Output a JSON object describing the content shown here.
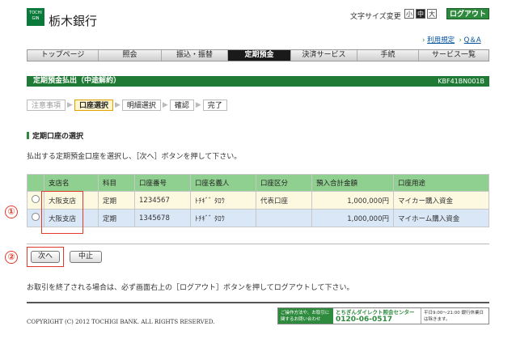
{
  "header": {
    "logo_text": "TOCHI GIN",
    "bank_name": "栃木銀行",
    "font_size_label": "文字サイズ変更",
    "font_sizes": [
      "小",
      "中",
      "大"
    ],
    "logout_label": "ログアウト",
    "links": [
      "利用規定",
      "Q＆A"
    ]
  },
  "nav": {
    "items": [
      "トップページ",
      "照会",
      "振込・振替",
      "定期預金",
      "決済サービス",
      "手続",
      "サービス一覧"
    ],
    "active_index": 3
  },
  "page": {
    "title": "定期預金払出（中途解約）",
    "code": "KBF41BN001B"
  },
  "steps": [
    "注意事項",
    "口座選択",
    "明細選択",
    "確認",
    "完了"
  ],
  "section": {
    "title": "定期口座の選択",
    "instruction": "払出する定期預金口座を選択し、［次へ］ボタンを押して下さい。"
  },
  "table": {
    "headers": [
      "",
      "支店名",
      "科目",
      "口座番号",
      "口座名義人",
      "口座区分",
      "預入合計金額",
      "口座用途"
    ],
    "rows": [
      [
        "",
        "大阪支店",
        "定期",
        "1234567",
        "ﾄﾁｷﾞﾞ ﾀﾛｳ",
        "代表口座",
        "1,000,000円",
        "マイカー購入資金"
      ],
      [
        "",
        "大阪支店",
        "定期",
        "1345678",
        "ﾄﾁｷﾞﾞ ﾀﾛｳ",
        "",
        "1,000,000円",
        "マイホーム購入資金"
      ]
    ]
  },
  "callouts": [
    "①",
    "②"
  ],
  "buttons": {
    "next": "次へ",
    "cancel": "中止"
  },
  "notice": "お取引を終了される場合は、必ず画面右上の［ログアウト］ボタンを押してログアウトして下さい。",
  "footer": {
    "copyright": "COPYRIGHT (C) 2012 TOCHIGI BANK. ALL RIGHTS RESERVED.",
    "banner_left": "ご操作方法や、お取引に関するお問い合わせ",
    "banner_title": "とちぎんダイレクト照会センター",
    "banner_phone": "0120-06-0517",
    "banner_hours": "平日9:00〜21:00 銀行休業日は除きます。"
  },
  "colors": {
    "brand_green": "#2e8b3e",
    "header_row": "#8fcf8f",
    "callout_red": "#e23a2a"
  }
}
